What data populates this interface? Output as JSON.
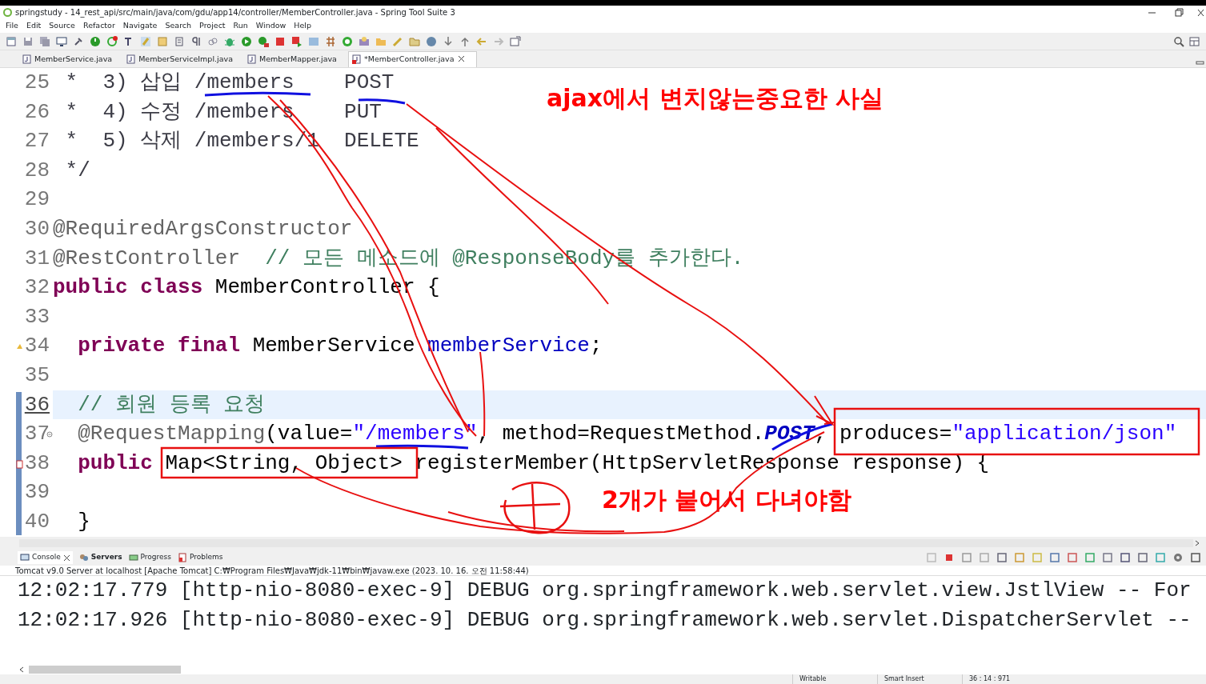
{
  "window": {
    "title": "springstudy - 14_rest_api/src/main/java/com/gdu/app14/controller/MemberController.java - Spring Tool Suite 3"
  },
  "menu": [
    "File",
    "Edit",
    "Source",
    "Refactor",
    "Navigate",
    "Search",
    "Project",
    "Run",
    "Window",
    "Help"
  ],
  "editor_tabs": [
    {
      "label": "MemberService.java",
      "selected": false,
      "error": false
    },
    {
      "label": "MemberServiceImpl.java",
      "selected": false,
      "error": false
    },
    {
      "label": "MemberMapper.java",
      "selected": false,
      "error": false
    },
    {
      "label": "*MemberController.java",
      "selected": true,
      "error": true
    }
  ],
  "editor": {
    "lines": [
      {
        "number": "25",
        "current": false,
        "tokens": [
          {
            "text": " *  3) 삽입 /members    POST",
            "kind": "doc"
          }
        ]
      },
      {
        "number": "26",
        "current": false,
        "tokens": [
          {
            "text": " *  4) 수정 /members    PUT",
            "kind": "doc"
          }
        ]
      },
      {
        "number": "27",
        "current": false,
        "tokens": [
          {
            "text": " *  5) 삭제 /members/1  DELETE",
            "kind": "doc"
          }
        ]
      },
      {
        "number": "28",
        "current": false,
        "tokens": [
          {
            "text": " */",
            "kind": "doc"
          }
        ]
      },
      {
        "number": "29",
        "current": false
      },
      {
        "number": "30",
        "current": false,
        "tokens": [
          {
            "text": "@RequiredArgsConstructor",
            "kind": "annotation"
          }
        ]
      },
      {
        "number": "31",
        "current": false,
        "tokens": [
          {
            "text": "@RestController",
            "kind": "annotation"
          },
          {
            "text": "  // 모든 메소드에 @ResponseBody를 추가한다.",
            "kind": "comment"
          }
        ]
      },
      {
        "number": "32",
        "current": false,
        "tokens": [
          {
            "text": "public class",
            "kind": "keyword"
          },
          {
            "text": " MemberController {",
            "kind": "plain"
          }
        ]
      },
      {
        "number": "33",
        "current": false
      },
      {
        "number": "34",
        "current": false,
        "warning": true,
        "tokens": [
          {
            "text": "  private final",
            "kind": "keyword"
          },
          {
            "text": " MemberService ",
            "kind": "plain"
          },
          {
            "text": "memberService",
            "kind": "field"
          },
          {
            "text": ";",
            "kind": "plain"
          }
        ]
      },
      {
        "number": "35",
        "current": false
      },
      {
        "number": "36",
        "current": true,
        "tokens": [
          {
            "text": "  // 회원 등록 요청",
            "kind": "comment"
          }
        ]
      },
      {
        "number": "37",
        "current": false,
        "foldable": true,
        "tokens": [
          {
            "text": "  @RequestMapping",
            "kind": "annotation"
          },
          {
            "text": "(value=",
            "kind": "plain"
          },
          {
            "text": "\"/members\"",
            "kind": "string"
          },
          {
            "text": ", method=RequestMethod.",
            "kind": "plain"
          },
          {
            "text": "POST",
            "kind": "static"
          },
          {
            "text": ", produces=",
            "kind": "plain"
          },
          {
            "text": "\"application/json\"",
            "kind": "string"
          }
        ]
      },
      {
        "number": "38",
        "current": false,
        "error": true,
        "tokens": [
          {
            "text": "  public",
            "kind": "keyword"
          },
          {
            "text": " Map<String, Object> registerMember(HttpServletResponse response) {",
            "kind": "plain"
          }
        ]
      },
      {
        "number": "39",
        "current": false
      },
      {
        "number": "40",
        "current": false,
        "tokens": [
          {
            "text": "  }",
            "kind": "plain"
          }
        ]
      }
    ]
  },
  "notes": [
    {
      "text": "ajax에서 변치않는중요한 사실",
      "color": "#ff0000"
    },
    {
      "text": "2개가 붙어서 다녀야함",
      "color": "#ff0000"
    }
  ],
  "console_tabs": [
    {
      "label": "Console",
      "selected": true,
      "busy": false
    },
    {
      "label": "Servers",
      "selected": false,
      "busy": true
    },
    {
      "label": "Progress",
      "selected": false,
      "busy": false
    },
    {
      "label": "Problems",
      "selected": false,
      "busy": false
    }
  ],
  "console": {
    "header": "Tomcat v9.0 Server at localhost [Apache Tomcat] C:₩Program Files₩Java₩jdk-11₩bin₩javaw.exe  (2023. 10. 16. 오전 11:58:44)",
    "lines": [
      "12:02:17.779 [http-nio-8080-exec-9] DEBUG org.springframework.web.servlet.view.JstlView -- For",
      "12:02:17.926 [http-nio-8080-exec-9] DEBUG org.springframework.web.servlet.DispatcherServlet --"
    ]
  },
  "status_bar": [
    "Writable",
    "Smart Insert",
    "36 : 14 : 971"
  ]
}
